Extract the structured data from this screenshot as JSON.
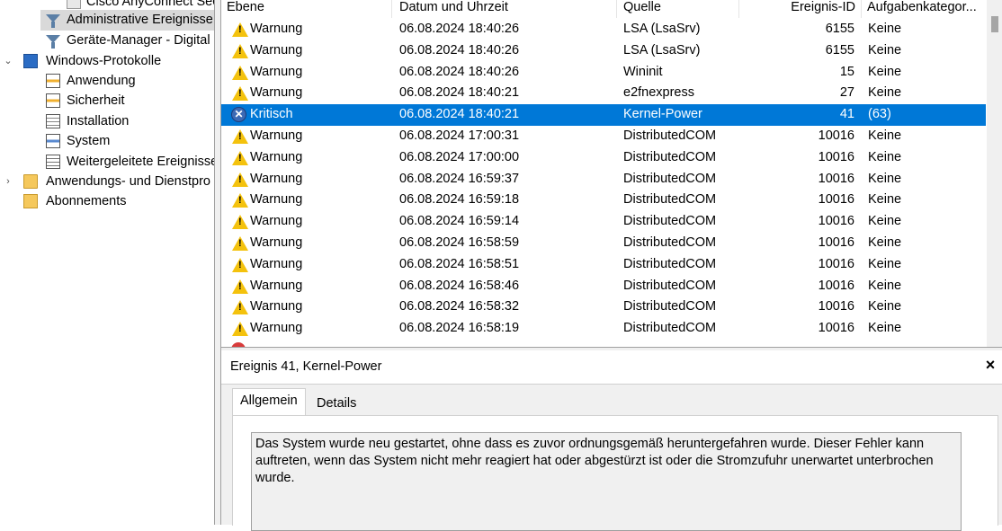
{
  "tree": {
    "items": [
      {
        "label": "Cisco AnyConnect Sec",
        "icon": "vpn-icon"
      },
      {
        "label": "Administrative Ereignisse",
        "icon": "filter-icon"
      },
      {
        "label": "Geräte-Manager - Digital",
        "icon": "filter-icon"
      },
      {
        "label": "Windows-Protokolle",
        "icon": "windows-logs-icon"
      },
      {
        "label": "Anwendung",
        "icon": "log-icon"
      },
      {
        "label": "Sicherheit",
        "icon": "log-icon"
      },
      {
        "label": "Installation",
        "icon": "log-icon"
      },
      {
        "label": "System",
        "icon": "log-icon"
      },
      {
        "label": "Weitergeleitete Ereignisse",
        "icon": "log-icon"
      },
      {
        "label": "Anwendungs- und Dienstpro",
        "icon": "folder-icon"
      },
      {
        "label": "Abonnements",
        "icon": "subscriptions-icon"
      }
    ],
    "expand_collapsed": "›",
    "expand_open": "⌄"
  },
  "list": {
    "headers": {
      "level": "Ebene",
      "date": "Datum und Uhrzeit",
      "source": "Quelle",
      "id": "Ereignis-ID",
      "category": "Aufgabenkategor..."
    },
    "rows": [
      {
        "level": "Warnung",
        "date": "06.08.2024 18:40:26",
        "source": "LSA (LsaSrv)",
        "id": "6155",
        "category": "Keine"
      },
      {
        "level": "Warnung",
        "date": "06.08.2024 18:40:26",
        "source": "LSA (LsaSrv)",
        "id": "6155",
        "category": "Keine"
      },
      {
        "level": "Warnung",
        "date": "06.08.2024 18:40:26",
        "source": "Wininit",
        "id": "15",
        "category": "Keine"
      },
      {
        "level": "Warnung",
        "date": "06.08.2024 18:40:21",
        "source": "e2fnexpress",
        "id": "27",
        "category": "Keine"
      },
      {
        "level": "Kritisch",
        "date": "06.08.2024 18:40:21",
        "source": "Kernel-Power",
        "id": "41",
        "category": "(63)"
      },
      {
        "level": "Warnung",
        "date": "06.08.2024 17:00:31",
        "source": "DistributedCOM",
        "id": "10016",
        "category": "Keine"
      },
      {
        "level": "Warnung",
        "date": "06.08.2024 17:00:00",
        "source": "DistributedCOM",
        "id": "10016",
        "category": "Keine"
      },
      {
        "level": "Warnung",
        "date": "06.08.2024 16:59:37",
        "source": "DistributedCOM",
        "id": "10016",
        "category": "Keine"
      },
      {
        "level": "Warnung",
        "date": "06.08.2024 16:59:18",
        "source": "DistributedCOM",
        "id": "10016",
        "category": "Keine"
      },
      {
        "level": "Warnung",
        "date": "06.08.2024 16:59:14",
        "source": "DistributedCOM",
        "id": "10016",
        "category": "Keine"
      },
      {
        "level": "Warnung",
        "date": "06.08.2024 16:58:59",
        "source": "DistributedCOM",
        "id": "10016",
        "category": "Keine"
      },
      {
        "level": "Warnung",
        "date": "06.08.2024 16:58:51",
        "source": "DistributedCOM",
        "id": "10016",
        "category": "Keine"
      },
      {
        "level": "Warnung",
        "date": "06.08.2024 16:58:46",
        "source": "DistributedCOM",
        "id": "10016",
        "category": "Keine"
      },
      {
        "level": "Warnung",
        "date": "06.08.2024 16:58:32",
        "source": "DistributedCOM",
        "id": "10016",
        "category": "Keine"
      },
      {
        "level": "Warnung",
        "date": "06.08.2024 16:58:19",
        "source": "DistributedCOM",
        "id": "10016",
        "category": "Keine"
      }
    ]
  },
  "detail": {
    "title": "Ereignis 41, Kernel-Power",
    "close": "×",
    "tabs": {
      "general": "Allgemein",
      "details": "Details"
    },
    "description": "Das System wurde neu gestartet, ohne dass es zuvor ordnungsgemäß heruntergefahren wurde. Dieser Fehler kann auftreten, wenn das System nicht mehr reagiert hat oder abgestürzt ist oder die Stromzufuhr unerwartet unterbrochen wurde."
  },
  "colors": {
    "selection": "#0078d7",
    "warning": "#f4c20d",
    "critical": "#3c6ab5"
  }
}
